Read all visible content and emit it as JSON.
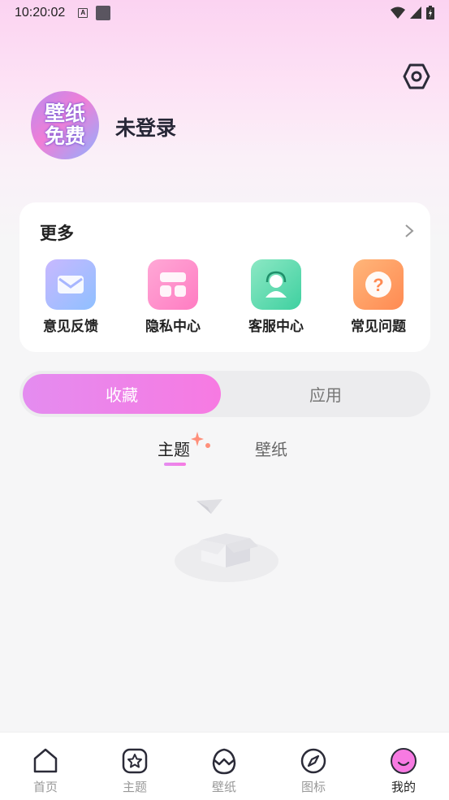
{
  "status_bar": {
    "time": "10:20:02",
    "notification_badge": "A"
  },
  "profile": {
    "avatar_text_line1": "壁纸",
    "avatar_text_line2": "免费",
    "login_status": "未登录"
  },
  "more_section": {
    "title": "更多",
    "items": [
      {
        "label": "意见反馈",
        "icon": "feedback-envelope-icon",
        "color": "#a7b6ff"
      },
      {
        "label": "隐私中心",
        "icon": "privacy-grid-icon",
        "color": "#ff8fc8"
      },
      {
        "label": "客服中心",
        "icon": "customer-service-icon",
        "color": "#5fe0b4"
      },
      {
        "label": "常见问题",
        "icon": "question-icon",
        "color": "#ff9f6a"
      }
    ]
  },
  "segmented": {
    "active": "收藏",
    "inactive": "应用"
  },
  "sub_tabs": {
    "active": "主题",
    "inactive": "壁纸"
  },
  "bottom_nav": [
    {
      "label": "首页",
      "icon": "home-icon",
      "active": false
    },
    {
      "label": "主题",
      "icon": "star-icon",
      "active": false
    },
    {
      "label": "壁纸",
      "icon": "egg-icon",
      "active": false
    },
    {
      "label": "图标",
      "icon": "compass-icon",
      "active": false
    },
    {
      "label": "我的",
      "icon": "smiley-icon",
      "active": true
    }
  ],
  "colors": {
    "accent_pink": "#f77ae2",
    "accent_purple": "#e48cf0"
  }
}
